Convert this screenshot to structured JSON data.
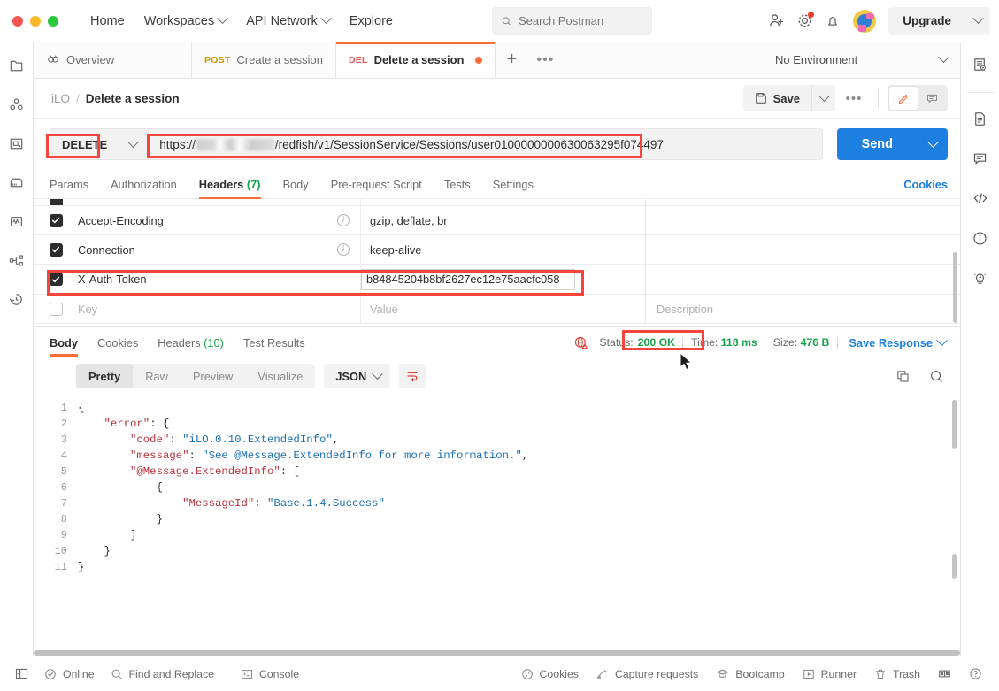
{
  "app": {
    "window_controls": [
      "close",
      "minimize",
      "maximize"
    ],
    "accent_orange": "#ff6c37",
    "annotation_red": "#f8453c",
    "send_blue": "#1d7fe0",
    "success_green": "#16a34a"
  },
  "header": {
    "nav": [
      {
        "label": "Home",
        "caret": false
      },
      {
        "label": "Workspaces",
        "caret": true
      },
      {
        "label": "API Network",
        "caret": true
      },
      {
        "label": "Explore",
        "caret": false
      }
    ],
    "search_placeholder": "Search Postman",
    "icons": [
      "invite-user-icon",
      "settings-gear-icon",
      "notification-bell-icon",
      "avatar"
    ],
    "upgrade_label": "Upgrade"
  },
  "tabs": [
    {
      "label": "Overview",
      "method": "",
      "icon": "overview-icon",
      "active": false,
      "unsaved": false
    },
    {
      "label": "Create a session",
      "method": "POST",
      "icon": "",
      "active": false,
      "unsaved": false
    },
    {
      "label": "Delete a session",
      "method": "DEL",
      "icon": "",
      "active": true,
      "unsaved": true
    }
  ],
  "tab_actions": {
    "new_tab": "+",
    "more": "•••"
  },
  "environment": {
    "selected": "No Environment"
  },
  "breadcrumb": {
    "collection": "iLO",
    "separator": "/",
    "request": "Delete a session"
  },
  "request_actions": {
    "save_label": "Save",
    "more_label": "•••",
    "edit_mode": "edit-pencil-icon",
    "comment_mode": "comment-icon"
  },
  "request": {
    "method": "DELETE",
    "url_prefix": "https://",
    "url_redacted": true,
    "url_suffix": "/redfish/v1/SessionService/Sessions/user010000000063006 3295f074497",
    "url_full_display": "/redfish/v1/SessionService/Sessions/user0100000000630063295f074497",
    "send_label": "Send"
  },
  "request_tabs": [
    {
      "label": "Params",
      "count": "",
      "active": false
    },
    {
      "label": "Authorization",
      "count": "",
      "active": false
    },
    {
      "label": "Headers",
      "count": "(7)",
      "active": true
    },
    {
      "label": "Body",
      "count": "",
      "active": false
    },
    {
      "label": "Pre-request Script",
      "count": "",
      "active": false
    },
    {
      "label": "Tests",
      "count": "",
      "active": false
    },
    {
      "label": "Settings",
      "count": "",
      "active": false
    }
  ],
  "cookies_link": "Cookies",
  "headers_table": {
    "columns": [
      "Key",
      "Value",
      "Description"
    ],
    "placeholder_row": {
      "key": "Key",
      "value": "Value",
      "description": "Description"
    },
    "rows": [
      {
        "checked": true,
        "key": "Accept-Encoding",
        "value": "gzip, deflate, br",
        "description": "",
        "has_info": true,
        "highlighted": false
      },
      {
        "checked": true,
        "key": "Connection",
        "value": "keep-alive",
        "description": "",
        "has_info": true,
        "highlighted": false
      },
      {
        "checked": true,
        "key": "X-Auth-Token",
        "value": "b84845204b8bf2627ec12e75aacfc058",
        "description": "",
        "has_info": false,
        "highlighted": true
      }
    ]
  },
  "response_tabs": [
    {
      "label": "Body",
      "count": "",
      "active": true
    },
    {
      "label": "Cookies",
      "count": "",
      "active": false
    },
    {
      "label": "Headers",
      "count": "(10)",
      "active": false
    },
    {
      "label": "Test Results",
      "count": "",
      "active": false
    }
  ],
  "response_meta": {
    "warning_icon": "globe-warning-icon",
    "status_label": "Status:",
    "status_value": "200 OK",
    "time_label": "Time:",
    "time_value": "118 ms",
    "size_label": "Size:",
    "size_value": "476 B",
    "save_response_label": "Save Response"
  },
  "response_view": {
    "modes": [
      "Pretty",
      "Raw",
      "Preview",
      "Visualize"
    ],
    "active_mode": "Pretty",
    "format": "JSON",
    "wrap_icon": "wrap-lines-icon",
    "copy_icon": "copy-icon",
    "search_icon": "search-icon"
  },
  "response_body": {
    "language": "json",
    "lines": [
      {
        "n": "1",
        "tokens": [
          {
            "t": "{",
            "c": "p"
          }
        ],
        "indent": 0
      },
      {
        "n": "2",
        "tokens": [
          {
            "t": "\"error\"",
            "c": "k"
          },
          {
            "t": ": {",
            "c": "p"
          }
        ],
        "indent": 1
      },
      {
        "n": "3",
        "tokens": [
          {
            "t": "\"code\"",
            "c": "k"
          },
          {
            "t": ": ",
            "c": "p"
          },
          {
            "t": "\"iLO.0.10.ExtendedInfo\"",
            "c": "s"
          },
          {
            "t": ",",
            "c": "p"
          }
        ],
        "indent": 2
      },
      {
        "n": "4",
        "tokens": [
          {
            "t": "\"message\"",
            "c": "k"
          },
          {
            "t": ": ",
            "c": "p"
          },
          {
            "t": "\"See @Message.ExtendedInfo for more information.\"",
            "c": "s"
          },
          {
            "t": ",",
            "c": "p"
          }
        ],
        "indent": 2
      },
      {
        "n": "5",
        "tokens": [
          {
            "t": "\"@Message.ExtendedInfo\"",
            "c": "k"
          },
          {
            "t": ": [",
            "c": "p"
          }
        ],
        "indent": 2
      },
      {
        "n": "6",
        "tokens": [
          {
            "t": "{",
            "c": "p"
          }
        ],
        "indent": 3
      },
      {
        "n": "7",
        "tokens": [
          {
            "t": "\"MessageId\"",
            "c": "k"
          },
          {
            "t": ": ",
            "c": "p"
          },
          {
            "t": "\"Base.1.4.Success\"",
            "c": "s"
          }
        ],
        "indent": 4
      },
      {
        "n": "8",
        "tokens": [
          {
            "t": "}",
            "c": "p"
          }
        ],
        "indent": 3
      },
      {
        "n": "9",
        "tokens": [
          {
            "t": "]",
            "c": "p"
          }
        ],
        "indent": 2
      },
      {
        "n": "10",
        "tokens": [
          {
            "t": "}",
            "c": "p"
          }
        ],
        "indent": 1
      },
      {
        "n": "11",
        "tokens": [
          {
            "t": "}",
            "c": "p"
          }
        ],
        "indent": 0
      }
    ]
  },
  "status_bar": {
    "left": [
      {
        "label": "",
        "icon": "sidebar-toggle-icon"
      },
      {
        "label": "Online",
        "icon": "online-check-icon"
      },
      {
        "label": "Find and Replace",
        "icon": "search-icon"
      },
      {
        "label": "Console",
        "icon": "console-icon"
      }
    ],
    "right": [
      {
        "label": "Cookies",
        "icon": "cookie-icon"
      },
      {
        "label": "Capture requests",
        "icon": "capture-icon"
      },
      {
        "label": "Bootcamp",
        "icon": "bootcamp-hat-icon"
      },
      {
        "label": "Runner",
        "icon": "runner-icon"
      },
      {
        "label": "Trash",
        "icon": "trash-icon"
      },
      {
        "label": "",
        "icon": "layout-panes-icon"
      },
      {
        "label": "",
        "icon": "help-circle-icon"
      }
    ]
  },
  "left_rail_icons": [
    "collections-icon",
    "environments-icon",
    "apis-icon",
    "mock-servers-icon",
    "monitors-icon",
    "flows-icon",
    "history-icon"
  ],
  "right_rail_icons": [
    "environment-quick-look-icon",
    "documentation-icon",
    "comments-icon",
    "code-snippet-icon",
    "info-icon",
    "lightbulb-icon"
  ],
  "annotations": [
    {
      "target": "method-selector",
      "color": "#f8453c"
    },
    {
      "target": "url-field",
      "color": "#f8453c"
    },
    {
      "target": "x-auth-token-row",
      "color": "#f8453c"
    },
    {
      "target": "response-status",
      "color": "#f8453c"
    }
  ]
}
